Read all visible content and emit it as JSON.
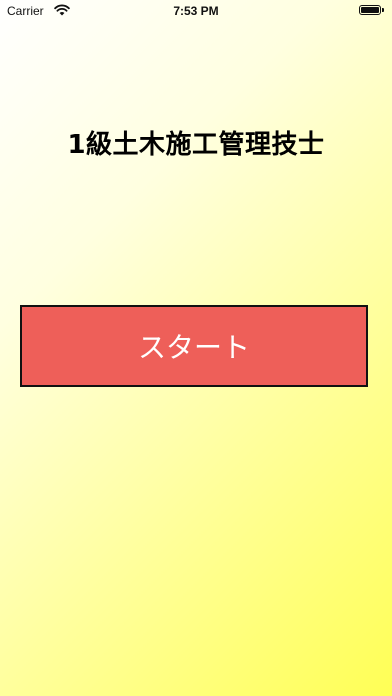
{
  "status_bar": {
    "carrier": "Carrier",
    "time": "7:53 PM",
    "wifi_icon": "wifi-icon",
    "battery_icon": "battery-icon"
  },
  "main": {
    "title": "1級土木施工管理技士",
    "start_button": "スタート"
  },
  "colors": {
    "button_background": "#ee5f59",
    "button_text": "#ffffff",
    "gradient_start": "#ffffff",
    "gradient_end": "#ffff55"
  }
}
